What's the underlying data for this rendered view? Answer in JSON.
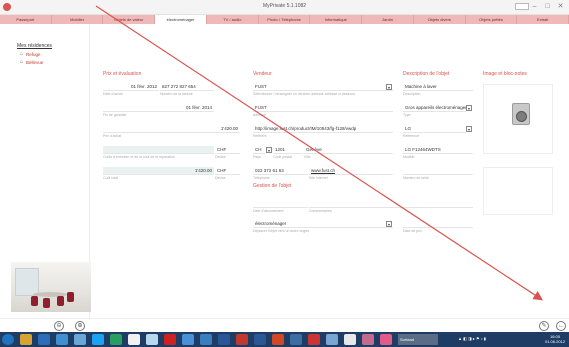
{
  "window": {
    "title": "MyPrivate 5.1.1082"
  },
  "tabs": [
    {
      "label": "Passeport",
      "active": false
    },
    {
      "label": "Mobilier",
      "active": false
    },
    {
      "label": "Objets de valeur",
      "active": false
    },
    {
      "label": "électroménager",
      "active": true
    },
    {
      "label": "TV / audio",
      "active": false
    },
    {
      "label": "Photo / Téléphonie",
      "active": false
    },
    {
      "label": "Informatique",
      "active": false
    },
    {
      "label": "Jardin",
      "active": false
    },
    {
      "label": "Objets divers",
      "active": false
    },
    {
      "label": "Objets prêtés",
      "active": false
    },
    {
      "label": "Extrait",
      "active": false
    }
  ],
  "sidebar": {
    "heading": "Mes résidences",
    "items": [
      {
        "label": "Refuge"
      },
      {
        "label": "Bellevue"
      }
    ]
  },
  "prix": {
    "title": "Prix et évaluation",
    "date_achat": "01 févr. 2012",
    "numero_facture": "827 272 827 654",
    "date_achat_label": "Date d'achat",
    "numero_facture_label": "Numéro de la facture",
    "fin_garantie": "01 févr. 2014",
    "fin_garantie_label": "Fin de garantie",
    "prix_achat": "1'420.00",
    "prix_achat_label": "Prix d'achat",
    "devise1": "CHF",
    "cout_label": "Coûts d'entretien et de la coût de la réparation",
    "devise_label1": "Devise",
    "cout_total": "1'420.00",
    "devise2": "CHF",
    "cout_total_label": "Coût total",
    "devise_label2": "Devise"
  },
  "vendeur": {
    "title": "Vendeur",
    "nom": "FUST",
    "nom_label": "Sélectionner / renseigner un vendeur adresse adresse ci-dessous",
    "adresse": "FUST",
    "adresse_label": "Adresse",
    "lien": "http://image.fust.ch/product/IM/10543/fg-f128/vwdp",
    "lien_label": "Référent",
    "pays": "CH",
    "code_postal": "1201",
    "ville": "Genève",
    "pays_label": "Pays",
    "code_postal_label": "Code postal",
    "ville_label": "Ville",
    "telephone": "022 372 61 63",
    "site": "www.fust.ch",
    "telephone_label": "Téléphone",
    "site_label": "Site internet"
  },
  "gestion": {
    "title": "Gestion de l'objet",
    "date_label": "Date d'abonnement",
    "commentaire_label": "Commentaires",
    "categorie": "électroménager",
    "categorie_label": "Déplacer l'objet vers un autre onglet",
    "date_prix_label": "Date de prix"
  },
  "description": {
    "title": "Description de l'objet",
    "nom": "Machine à laver",
    "nom_label": "Description",
    "type": "Gros appareils électroménager",
    "type_label": "Type",
    "marque": "LG",
    "marque_label": "Référence",
    "modele": "LG F12464WDTS",
    "modele_label": "Modèle",
    "serie_label": "Numéro de série"
  },
  "images": {
    "title": "Image et bloc-notes"
  },
  "taskbar": {
    "active_item": "Sortead",
    "time": "16:05",
    "date": "01.06.2012"
  }
}
